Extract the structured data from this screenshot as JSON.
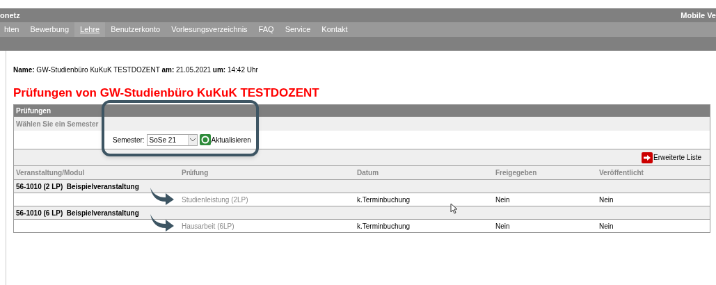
{
  "header": {
    "site_title": "onetz",
    "mobile_link": "Mobile Ve"
  },
  "nav": [
    {
      "label": "hten",
      "selected": false
    },
    {
      "label": "Bewerbung",
      "selected": false
    },
    {
      "label": "Lehre",
      "selected": true
    },
    {
      "label": "Benutzerkonto",
      "selected": false
    },
    {
      "label": "Vorlesungsverzeichnis",
      "selected": false
    },
    {
      "label": "FAQ",
      "selected": false
    },
    {
      "label": "Service",
      "selected": false
    },
    {
      "label": "Kontakt",
      "selected": false
    }
  ],
  "info_line": "**Name:** GW-Studienbüro KuKuK TESTDOZENT **am:** 21.05.2021 **um:** 14:42 Uhr",
  "page_title": "Prüfungen von GW-Studienbüro KuKuK TESTDOZENT",
  "panel": {
    "title": "Prüfungen",
    "subtitle": "Wählen Sie ein Semester",
    "semester_label": "Semester:",
    "semester_value": "SoSe 21",
    "refresh_label": "Aktualisieren",
    "extended_list_label": "Erweiterte Liste",
    "columns": [
      "Veranstaltung/Modul",
      "Prüfung",
      "Datum",
      "Freigegeben",
      "Veröffentlicht"
    ],
    "groups": [
      {
        "module": "56-1010 (2 LP)  Beispielveranstaltung",
        "exams": [
          {
            "name": "Studienleistung (2LP)",
            "date": "k.Terminbuchung",
            "released": "Nein",
            "published": "Nein"
          }
        ]
      },
      {
        "module": "56-1010 (6 LP)  Beispielveranstaltung",
        "exams": [
          {
            "name": "Hausarbeit (6LP)",
            "date": "k.Terminbuchung",
            "released": "Nein",
            "published": "Nein"
          }
        ]
      }
    ]
  }
}
